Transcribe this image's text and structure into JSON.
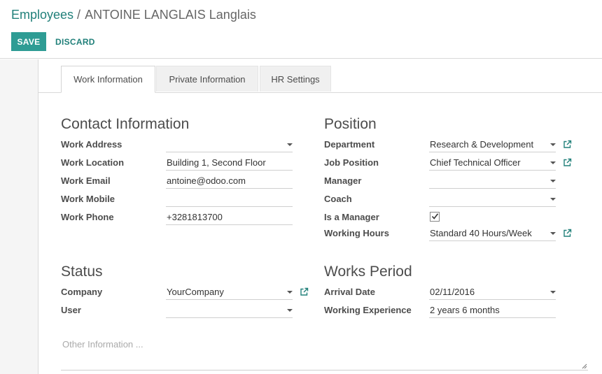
{
  "breadcrumb": {
    "parent": "Employees",
    "separator": "/",
    "current": "ANTOINE LANGLAIS Langlais"
  },
  "buttons": {
    "save": "SAVE",
    "discard": "DISCARD"
  },
  "tabs": [
    "Work Information",
    "Private Information",
    "HR Settings"
  ],
  "contact": {
    "title": "Contact Information",
    "work_address": {
      "label": "Work Address",
      "value": ""
    },
    "work_location": {
      "label": "Work Location",
      "value": "Building 1, Second Floor"
    },
    "work_email": {
      "label": "Work Email",
      "value": "antoine@odoo.com"
    },
    "work_mobile": {
      "label": "Work Mobile",
      "value": ""
    },
    "work_phone": {
      "label": "Work Phone",
      "value": "+3281813700"
    }
  },
  "position": {
    "title": "Position",
    "department": {
      "label": "Department",
      "value": "Research & Development"
    },
    "job_position": {
      "label": "Job Position",
      "value": "Chief Technical Officer"
    },
    "manager": {
      "label": "Manager",
      "value": ""
    },
    "coach": {
      "label": "Coach",
      "value": ""
    },
    "is_manager": {
      "label": "Is a Manager",
      "checked": true
    },
    "working_hours": {
      "label": "Working Hours",
      "value": "Standard 40 Hours/Week"
    }
  },
  "status": {
    "title": "Status",
    "company": {
      "label": "Company",
      "value": "YourCompany"
    },
    "user": {
      "label": "User",
      "value": ""
    }
  },
  "works_period": {
    "title": "Works Period",
    "arrival_date": {
      "label": "Arrival Date",
      "value": "02/11/2016"
    },
    "working_experience": {
      "label": "Working Experience",
      "value": "2 years 6 months"
    }
  },
  "notes": {
    "placeholder": "Other Information ..."
  },
  "colors": {
    "accent": "#2e9c94",
    "link": "#21807a"
  }
}
